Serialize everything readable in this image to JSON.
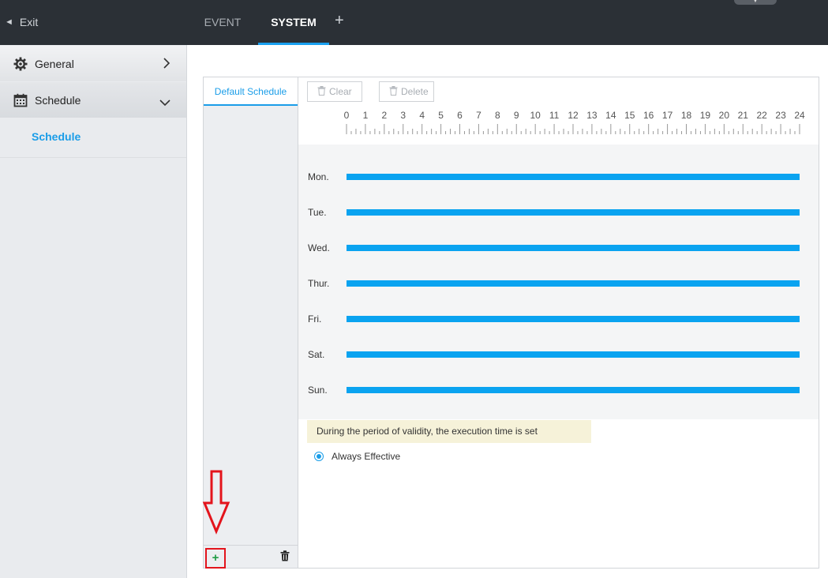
{
  "topbar": {
    "exit_label": "Exit",
    "tabs": [
      {
        "label": "EVENT",
        "active": false
      },
      {
        "label": "SYSTEM",
        "active": true
      }
    ],
    "add_tab_symbol": "+"
  },
  "sidebar": {
    "items": [
      {
        "label": "General",
        "icon": "gear-icon",
        "expanded": false
      },
      {
        "label": "Schedule",
        "icon": "calendar-icon",
        "expanded": true
      }
    ],
    "sub_items": [
      {
        "label": "Schedule",
        "selected": true
      }
    ]
  },
  "schedule_list": {
    "items": [
      {
        "label": "Default Schedule",
        "selected": true
      }
    ],
    "add_symbol": "+"
  },
  "toolbar": {
    "clear_label": "Clear",
    "delete_label": "Delete"
  },
  "timeline": {
    "hours": [
      "0",
      "1",
      "2",
      "3",
      "4",
      "5",
      "6",
      "7",
      "8",
      "9",
      "10",
      "11",
      "12",
      "13",
      "14",
      "15",
      "16",
      "17",
      "18",
      "19",
      "20",
      "21",
      "22",
      "23",
      "24"
    ]
  },
  "chart_data": {
    "type": "bar",
    "categories": [
      "Mon.",
      "Tue.",
      "Wed.",
      "Thur.",
      "Fri.",
      "Sat.",
      "Sun."
    ],
    "series": [
      {
        "ranges": [
          [
            0,
            24
          ],
          [
            0,
            24
          ],
          [
            0,
            24
          ],
          [
            0,
            24
          ],
          [
            0,
            24
          ],
          [
            0,
            24
          ],
          [
            0,
            24
          ]
        ]
      }
    ],
    "xlim": [
      0,
      24
    ],
    "bar_color": "#0aa3f0"
  },
  "validity": {
    "note": "During the period of validity, the execution time is set",
    "option_label": "Always Effective",
    "option_selected": true
  },
  "colors": {
    "accent": "#1a9de8",
    "topbar": "#2b3036",
    "annotation": "#e3141c"
  }
}
